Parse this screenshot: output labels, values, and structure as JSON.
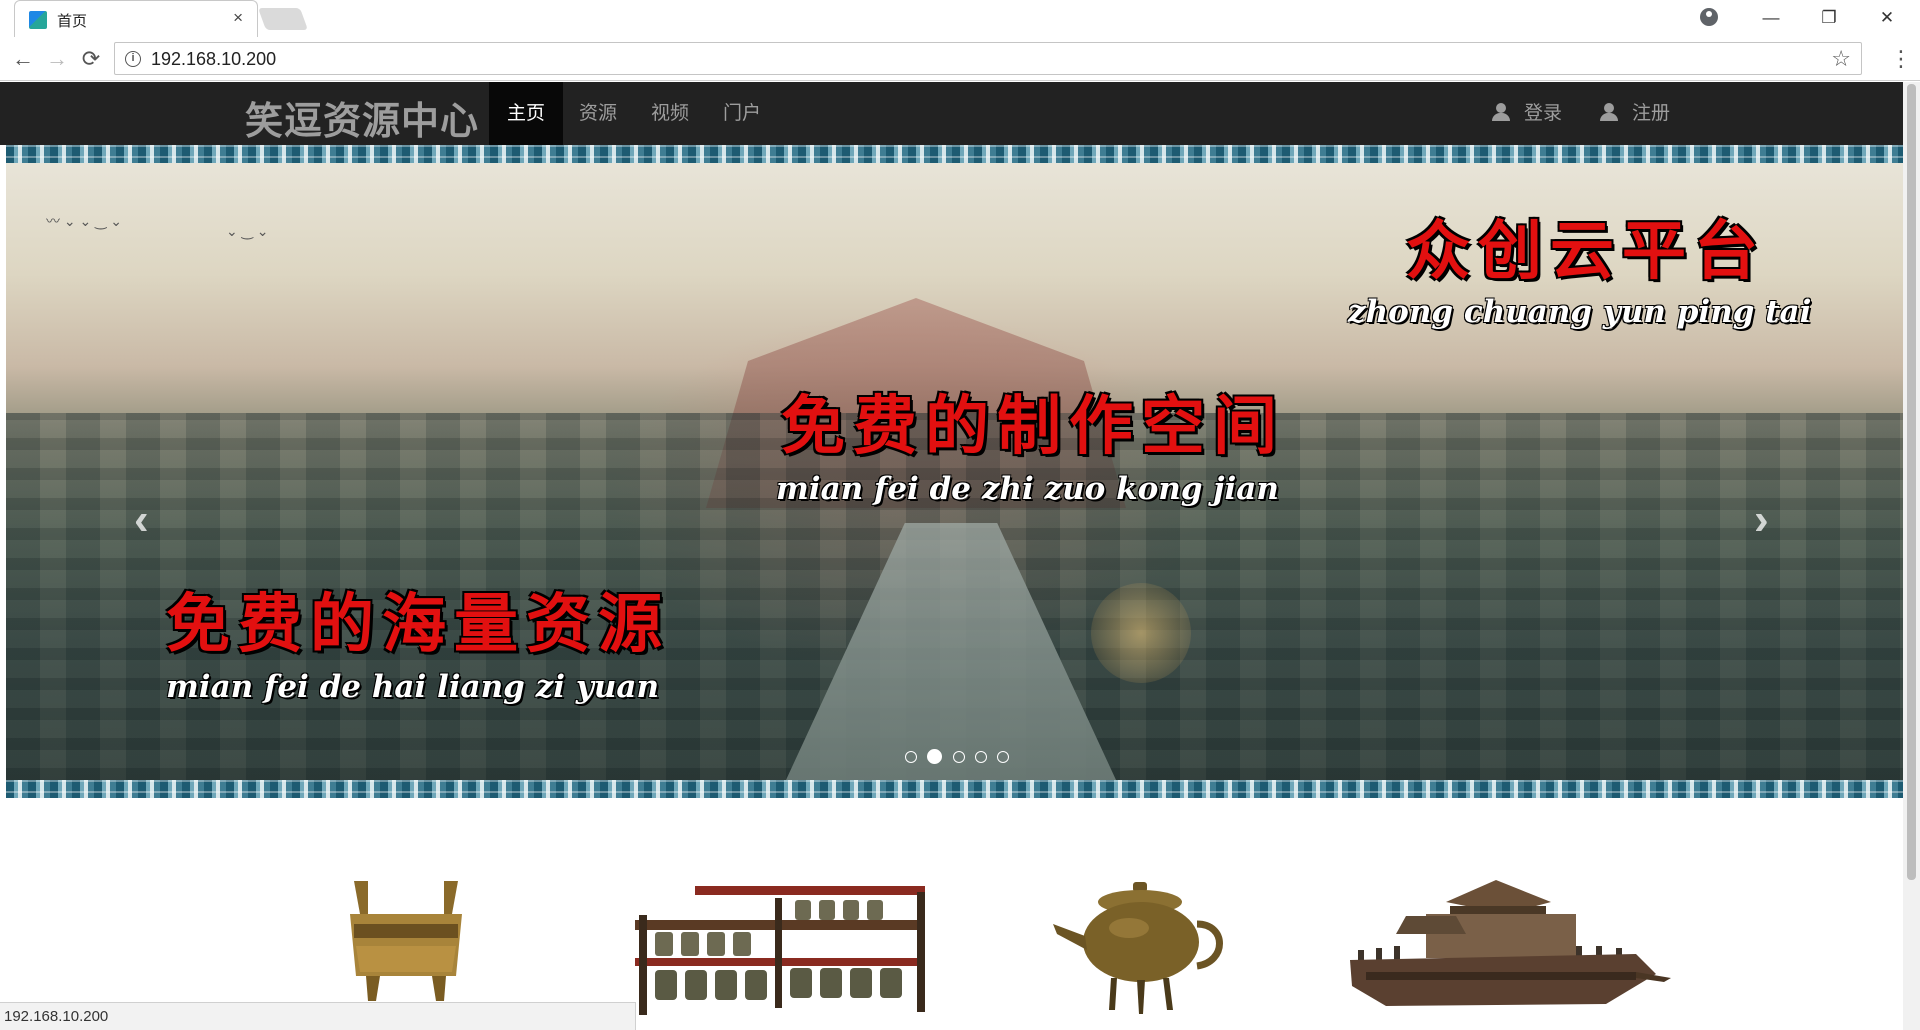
{
  "browser": {
    "tab_title": "首页",
    "tab_close": "×",
    "url": "192.168.10.200",
    "window_buttons": {
      "minimize": "—",
      "restore": "❐",
      "close": "✕"
    },
    "nav": {
      "back": "←",
      "forward": "→",
      "reload": "⟳"
    },
    "star": "☆",
    "menu": "⋮",
    "status_url": "192.168.10.200"
  },
  "site": {
    "brand": "笑逗资源中心",
    "nav_items": [
      "主页",
      "资源",
      "视频",
      "门户"
    ],
    "active_nav": "主页",
    "login": "登录",
    "register": "注册"
  },
  "carousel": {
    "slogans": [
      {
        "cn": "众创云平台",
        "pinyin": "zhong chuang yun ping tai"
      },
      {
        "cn": "免费的制作空间",
        "pinyin": "mian fei de zhi zuo kong jian"
      },
      {
        "cn": "免费的海量资源",
        "pinyin": "mian fei de hai liang zi yuan"
      }
    ],
    "prev": "‹",
    "next": "›",
    "slide_count": 5,
    "active_slide": 2
  },
  "colors": {
    "navbar": "#222222",
    "nav_active": "#080808",
    "slogan_red": "#e21010"
  },
  "artifacts": [
    "bronze-ding-icon",
    "chime-bells-icon",
    "bronze-teapot-icon",
    "wooden-boat-icon"
  ]
}
